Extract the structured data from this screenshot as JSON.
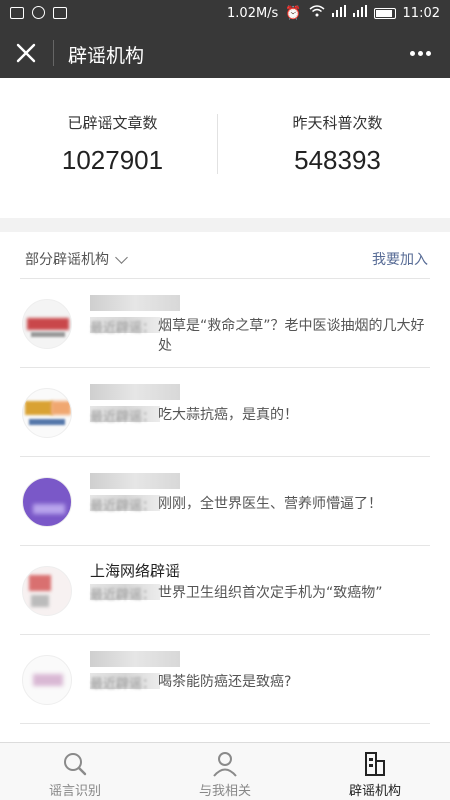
{
  "status": {
    "speed": "1.02M/s",
    "time": "11:02"
  },
  "header": {
    "title": "辟谣机构"
  },
  "stats": {
    "left": {
      "label": "已辟谣文章数",
      "value": "1027901"
    },
    "right": {
      "label": "昨天科普次数",
      "value": "548393"
    }
  },
  "section": {
    "title": "部分辟谣机构",
    "join": "我要加入"
  },
  "items": [
    {
      "name": "",
      "prefix": "最近辟谣：",
      "snippet": "烟草是“救命之草”？老中医谈抽烟的几大好处"
    },
    {
      "name": "",
      "prefix": "最近辟谣：",
      "snippet": "吃大蒜抗癌，是真的！"
    },
    {
      "name": "",
      "prefix": "最近辟谣：",
      "snippet": "刚刚，全世界医生、营养师懵逼了！"
    },
    {
      "name": "上海网络辟谣",
      "prefix": "最近辟谣：",
      "snippet": "世界卫生组织首次定手机为“致癌物”"
    },
    {
      "name": "",
      "prefix": "最近辟谣：",
      "snippet": "喝茶能防癌还是致癌?"
    }
  ],
  "tabs": [
    {
      "label": "谣言识别",
      "icon": "search-icon"
    },
    {
      "label": "与我相关",
      "icon": "person-icon"
    },
    {
      "label": "辟谣机构",
      "icon": "building-icon"
    }
  ]
}
